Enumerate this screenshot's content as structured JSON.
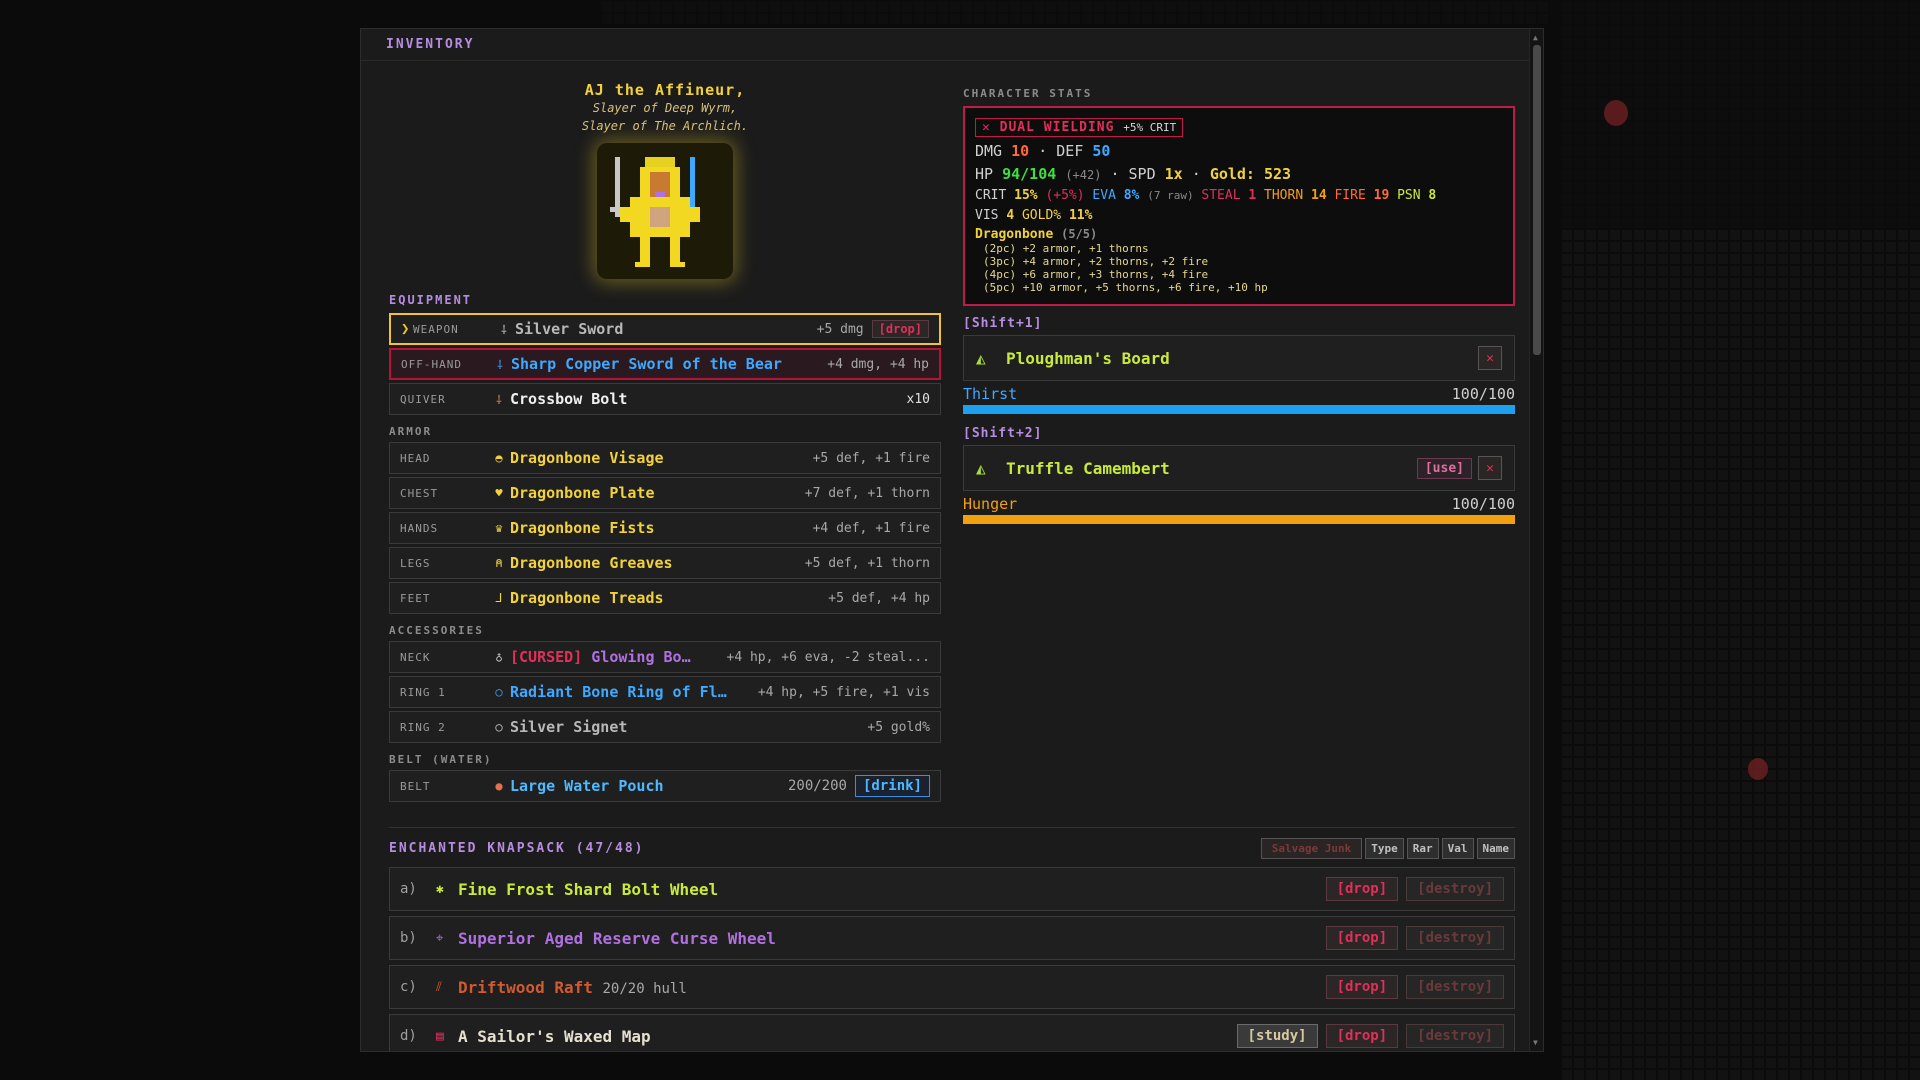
{
  "panel": {
    "title": "INVENTORY"
  },
  "character": {
    "name": "AJ the Affineur,",
    "titles": [
      "Slayer of Deep Wyrm,",
      "Slayer of The Archlich."
    ]
  },
  "equipment": {
    "label": "EQUIPMENT",
    "weapons": [
      {
        "slot": "WEAPON",
        "icon": "⸸",
        "name": "Silver Sword",
        "stats": "+5 dmg",
        "color": "#b8b8b8",
        "action": "[drop]"
      },
      {
        "slot": "OFF-HAND",
        "icon": "⸸",
        "name": "Sharp Copper Sword of the Bear",
        "stats": "+4 dmg, +4 hp",
        "color": "#3fa8ff"
      },
      {
        "slot": "QUIVER",
        "icon": "⸸",
        "name": "Crossbow Bolt",
        "stats": "x10",
        "color": "#f0f0f0"
      }
    ],
    "armor_label": "ARMOR",
    "armor": [
      {
        "slot": "HEAD",
        "icon": "◓",
        "name": "Dragonbone Visage",
        "stats": "+5 def, +1 fire"
      },
      {
        "slot": "CHEST",
        "icon": "♥",
        "name": "Dragonbone Plate",
        "stats": "+7 def, +1 thorn"
      },
      {
        "slot": "HANDS",
        "icon": "♛",
        "name": "Dragonbone Fists",
        "stats": "+4 def, +1 fire"
      },
      {
        "slot": "LEGS",
        "icon": "⍝",
        "name": "Dragonbone Greaves",
        "stats": "+5 def, +1 thorn"
      },
      {
        "slot": "FEET",
        "icon": "⅃",
        "name": "Dragonbone Treads",
        "stats": "+5 def, +4 hp"
      }
    ],
    "accessories_label": "ACCESSORIES",
    "accessories": [
      {
        "slot": "NECK",
        "icon": "♁",
        "cursed": "[CURSED]",
        "name": "Glowing Bo…",
        "stats": "+4 hp, +6 eva, -2 steal...",
        "color": "#b070e0"
      },
      {
        "slot": "RING 1",
        "icon": "○",
        "name": "Radiant Bone Ring of Fl…",
        "stats": "+4 hp, +5 fire, +1 vis",
        "color": "#3fa8ff"
      },
      {
        "slot": "RING 2",
        "icon": "○",
        "name": "Silver Signet",
        "stats": "+5 gold%",
        "color": "#b8b8b8"
      }
    ],
    "belt_label": "BELT (WATER)",
    "belt": {
      "slot": "BELT",
      "icon": "●",
      "name": "Large Water Pouch",
      "stats": "200/200",
      "action": "[drink]"
    }
  },
  "stats": {
    "label": "CHARACTER STATS",
    "dual_icon": "✕",
    "dual": "DUAL WIELDING",
    "dual_bonus": "+5% CRIT",
    "dmg_label": "DMG",
    "dmg": "10",
    "def_label": "DEF",
    "def": "50",
    "hp_label": "HP",
    "hp": "94/104",
    "hp_bonus": "(+42)",
    "spd_label": "SPD",
    "spd": "1x",
    "gold_label": "Gold:",
    "gold": "523",
    "crit_label": "CRIT",
    "crit": "15%",
    "crit_bonus": "(+5%)",
    "eva_label": "EVA",
    "eva": "8%",
    "eva_raw": "(7 raw)",
    "steal_label": "STEAL",
    "steal": "1",
    "thorn_label": "THORN",
    "thorn": "14",
    "fire_label": "FIRE",
    "fire": "19",
    "psn_label": "PSN",
    "psn": "8",
    "vis_label": "VIS",
    "vis": "4",
    "goldp_label": "GOLD%",
    "goldp": "11%",
    "set_name": "Dragonbone",
    "set_count": "(5/5)",
    "set_lines": [
      "(2pc) +2 armor, +1 thorns",
      "(3pc) +4 armor, +2 thorns, +2 fire",
      "(4pc) +6 armor, +3 thorns, +4 fire",
      "(5pc) +10 armor, +5 thorns, +6 fire, +10 hp"
    ]
  },
  "quick": [
    {
      "shift": "[Shift+1]",
      "icon": "◭",
      "name": "Ploughman's Board",
      "bar_label": "Thirst",
      "bar_value": "100/100",
      "bar_fraction": 1.0,
      "bar_color": "#1ea0f0",
      "use": ""
    },
    {
      "shift": "[Shift+2]",
      "icon": "◭",
      "name": "Truffle Camembert",
      "bar_label": "Hunger",
      "bar_value": "100/100",
      "bar_fraction": 1.0,
      "bar_color": "#f2a010",
      "use": "[use]"
    }
  ],
  "knapsack": {
    "title": "ENCHANTED KNAPSACK (47/48)",
    "sort": [
      "Salvage Junk",
      "Type",
      "Rar",
      "Val",
      "Name"
    ],
    "items": [
      {
        "letter": "a)",
        "icon": "✱",
        "name": "Fine Frost Shard Bolt Wheel",
        "extra": "",
        "color": "#c8ea3c",
        "icon_color": "#c8ea3c",
        "study": ""
      },
      {
        "letter": "b)",
        "icon": "⌖",
        "name": "Superior Aged Reserve Curse Wheel",
        "extra": "",
        "color": "#b070e0",
        "icon_color": "#b070e0",
        "study": ""
      },
      {
        "letter": "c)",
        "icon": "⫽",
        "name": "Driftwood Raft",
        "extra": "20/20 hull",
        "color": "#d05a30",
        "icon_color": "#d05a30",
        "study": ""
      },
      {
        "letter": "d)",
        "icon": "▤",
        "name": "A Sailor's Waxed Map",
        "extra": "",
        "color": "#e6e0d0",
        "icon_color": "#e0305a",
        "study": "[study]"
      }
    ],
    "drop": "[drop]",
    "destroy": "[destroy]"
  }
}
